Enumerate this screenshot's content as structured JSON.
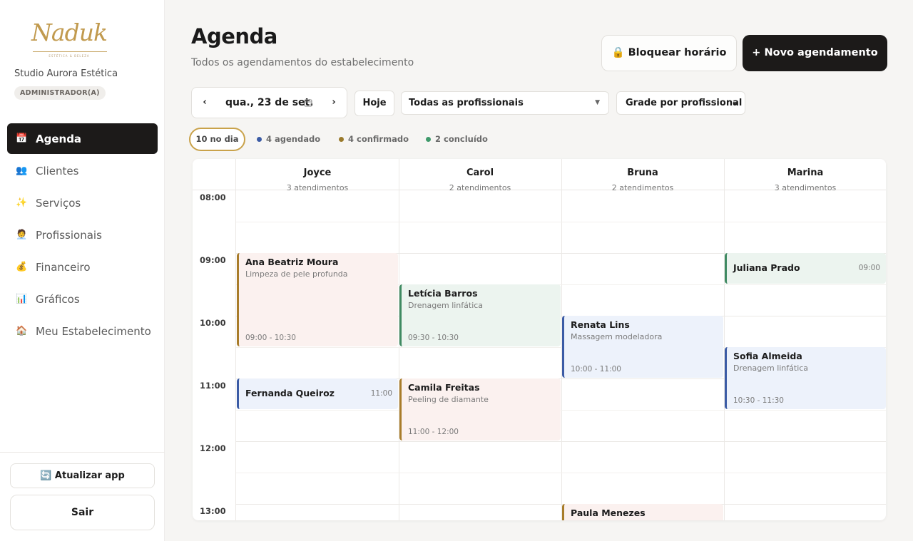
{
  "brand": {
    "logo_text": "Naduk",
    "logo_subtext": "ESTÉTICA & BELEZA",
    "studio_name": "Studio Aurora Estética",
    "role": "ADMINISTRADOR(A)"
  },
  "sidebar": {
    "items": [
      {
        "label": "Agenda",
        "icon": "calendar-icon",
        "glyph": "📅",
        "active": true
      },
      {
        "label": "Clientes",
        "icon": "people-icon",
        "glyph": "👥",
        "active": false
      },
      {
        "label": "Serviços",
        "icon": "sparkles-icon",
        "glyph": "✨",
        "active": false
      },
      {
        "label": "Profissionais",
        "icon": "professional-icon",
        "glyph": "🧑‍💼",
        "active": false
      },
      {
        "label": "Financeiro",
        "icon": "money-bag-icon",
        "glyph": "💰",
        "active": false
      },
      {
        "label": "Gráficos",
        "icon": "bar-chart-icon",
        "glyph": "📊",
        "active": false
      },
      {
        "label": "Meu Estabelecimento",
        "icon": "house-icon",
        "glyph": "🏠",
        "active": false
      }
    ],
    "update_button": "🔄 Atualizar app",
    "exit_button": "Sair"
  },
  "header": {
    "title": "Agenda",
    "subtitle": "Todos os agendamentos do estabelecimento",
    "block_button": "🔒 Bloquear horário",
    "new_button": "+ Novo agendamento"
  },
  "toolbar": {
    "prev": "‹",
    "next": "›",
    "date": "qua., 23 de set.",
    "today": "Hoje",
    "professional_filter": "Todas as profissionais",
    "view_mode": "Grade por profissional"
  },
  "chips": {
    "day_total": "10 no dia",
    "scheduled": {
      "label": "4 agendado",
      "color": "#3b5ba5"
    },
    "confirmed": {
      "label": "4 confirmado",
      "color": "#9a7a2c"
    },
    "completed": {
      "label": "2 concluído",
      "color": "#3f9a6b"
    }
  },
  "calendar": {
    "hours": [
      "08:00",
      "09:00",
      "10:00",
      "11:00",
      "12:00",
      "13:00"
    ],
    "professionals": [
      {
        "name": "Joyce",
        "count": "3 atendimentos"
      },
      {
        "name": "Carol",
        "count": "2 atendimentos"
      },
      {
        "name": "Bruna",
        "count": "2 atendimentos"
      },
      {
        "name": "Marina",
        "count": "3 atendimentos"
      }
    ],
    "events": [
      {
        "col": 0,
        "client": "Ana Beatriz Moura",
        "service": "Limpeza de pele profunda",
        "time": "09:00 - 10:30",
        "start": 1.0,
        "end": 2.5,
        "status": "confirmado",
        "bg": "#fbf1ef",
        "border": "#a87c2a",
        "compact": false
      },
      {
        "col": 0,
        "client": "Fernanda Queiroz",
        "service": "",
        "time": "11:00",
        "start": 3.0,
        "end": 3.5,
        "status": "agendado",
        "bg": "#edf2fb",
        "border": "#3b5ba5",
        "compact": true
      },
      {
        "col": 1,
        "client": "Letícia Barros",
        "service": "Drenagem linfática",
        "time": "09:30 - 10:30",
        "start": 1.5,
        "end": 2.5,
        "status": "concluído",
        "bg": "#ecf4ef",
        "border": "#3f8a62",
        "compact": false
      },
      {
        "col": 1,
        "client": "Camila Freitas",
        "service": "Peeling de diamante",
        "time": "11:00 - 12:00",
        "start": 3.0,
        "end": 4.0,
        "status": "confirmado",
        "bg": "#fbf1ef",
        "border": "#a87c2a",
        "compact": false
      },
      {
        "col": 2,
        "client": "Renata Lins",
        "service": "Massagem modeladora",
        "time": "10:00 - 11:00",
        "start": 2.0,
        "end": 3.0,
        "status": "agendado",
        "bg": "#edf2fb",
        "border": "#3b5ba5",
        "compact": false
      },
      {
        "col": 2,
        "client": "Paula Menezes",
        "service": "",
        "time": "",
        "start": 5.0,
        "end": 5.5,
        "status": "confirmado",
        "bg": "#fbf1ef",
        "border": "#a87c2a",
        "compact": false
      },
      {
        "col": 3,
        "client": "Juliana Prado",
        "service": "",
        "time": "09:00",
        "start": 1.0,
        "end": 1.5,
        "status": "concluído",
        "bg": "#ecf4ef",
        "border": "#3f8a62",
        "compact": true
      },
      {
        "col": 3,
        "client": "Sofia Almeida",
        "service": "Drenagem linfática",
        "time": "10:30 - 11:30",
        "start": 2.5,
        "end": 3.5,
        "status": "agendado",
        "bg": "#edf2fb",
        "border": "#3b5ba5",
        "compact": false
      }
    ]
  }
}
